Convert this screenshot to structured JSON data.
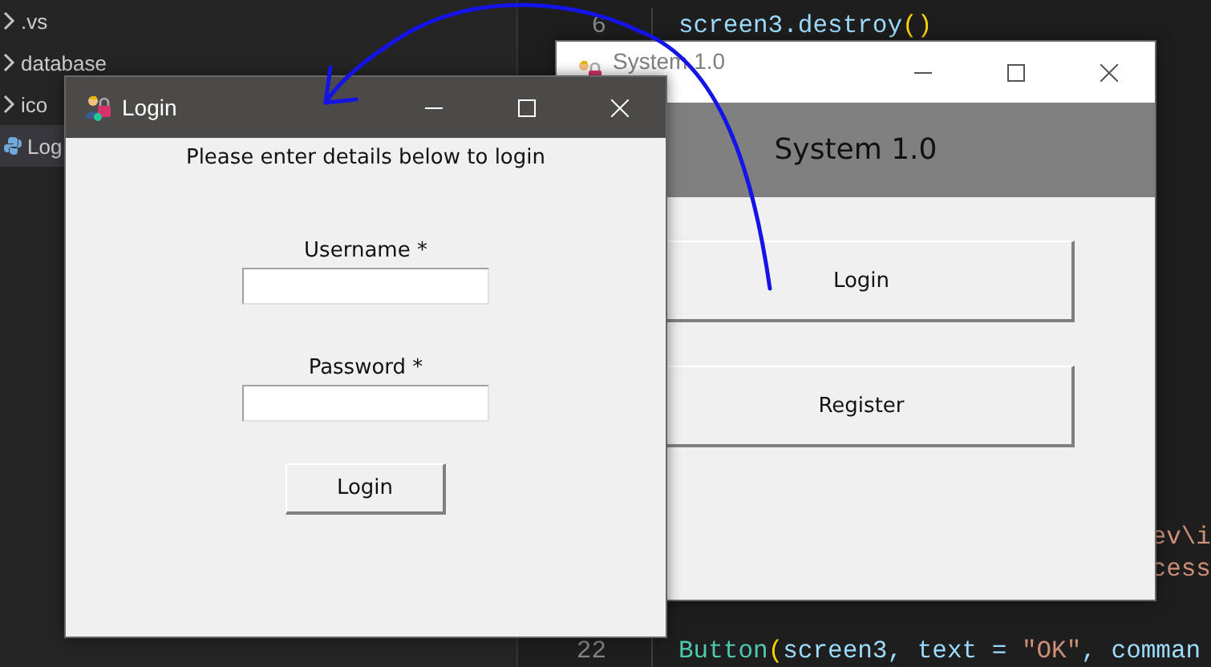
{
  "explorer": {
    "items": [
      {
        "kind": "folder",
        "label": ".vs",
        "selected": false
      },
      {
        "kind": "folder",
        "label": "database",
        "selected": false
      },
      {
        "kind": "folder",
        "label": "ico",
        "selected": false
      },
      {
        "kind": "file",
        "label": "Log",
        "selected": true
      }
    ]
  },
  "editor": {
    "top_line": {
      "number": "6",
      "tokens": [
        {
          "kind": "name",
          "text": "screen3.destroy"
        },
        {
          "kind": "bracket",
          "text": "()"
        }
      ]
    },
    "right_fragments": [
      {
        "text": "ev\\i"
      },
      {
        "text": "cess"
      }
    ],
    "bottom_line": {
      "number": "22",
      "tokens": [
        {
          "kind": "class",
          "text": "Button"
        },
        {
          "kind": "bracket",
          "text": "("
        },
        {
          "kind": "name",
          "text": "screen3, text = "
        },
        {
          "kind": "string",
          "text": "\"OK\""
        },
        {
          "kind": "name",
          "text": ", comman"
        }
      ]
    }
  },
  "windows": [
    {
      "title": "System 1.0",
      "active": false,
      "header": "System 1.0",
      "buttons": [
        "Login",
        "Register"
      ]
    },
    {
      "title": "Login",
      "active": true,
      "prompt": "Please enter details below to login",
      "fields": [
        {
          "label": "Username *"
        },
        {
          "label": "Password *"
        }
      ],
      "button": "Login"
    }
  ]
}
